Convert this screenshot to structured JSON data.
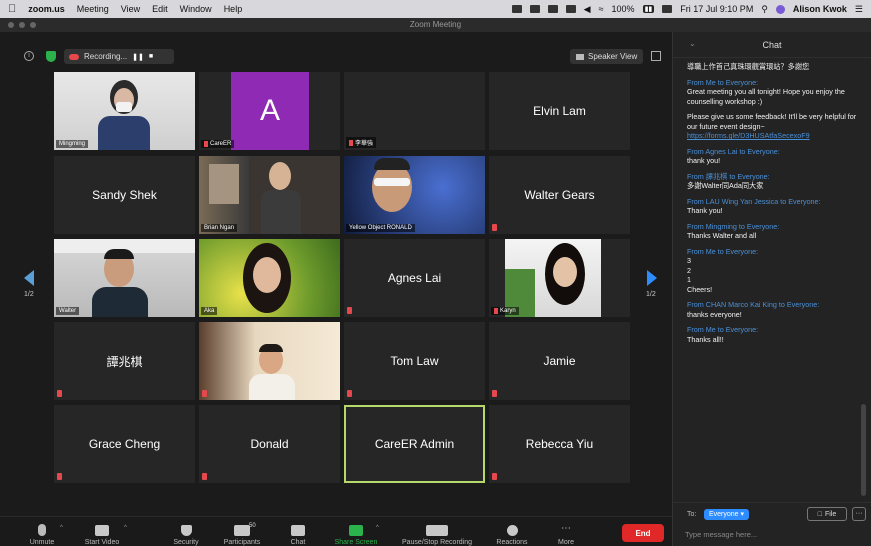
{
  "menubar": {
    "app": "zoom.us",
    "items": [
      "Meeting",
      "View",
      "Edit",
      "Window",
      "Help"
    ],
    "battery": "100%",
    "datetime": "Fri 17 Jul 9:10 PM",
    "user": "Alison Kwok"
  },
  "window": {
    "title": "Zoom Meeting"
  },
  "topbar": {
    "recording_label": "Recording...",
    "speaker_view": "Speaker View"
  },
  "pagination": {
    "left": "1/2",
    "right": "1/2"
  },
  "tiles": [
    {
      "name": "Mingming",
      "kind": "video"
    },
    {
      "name": "CareER",
      "kind": "avatar",
      "initial": "A"
    },
    {
      "name": "李華強",
      "kind": "label"
    },
    {
      "name": "Elvin Lam",
      "kind": "name"
    },
    {
      "name": "Sandy Shek",
      "kind": "name"
    },
    {
      "name": "Brian Ngan",
      "kind": "video"
    },
    {
      "name": "Yellow Object RONALD",
      "kind": "video"
    },
    {
      "name": "Walter Gears",
      "kind": "name"
    },
    {
      "name": "Walter",
      "kind": "video"
    },
    {
      "name": "Aka",
      "kind": "video"
    },
    {
      "name": "Agnes Lai",
      "kind": "name"
    },
    {
      "name": "Karyn",
      "kind": "video"
    },
    {
      "name": "譚兆棋",
      "kind": "name"
    },
    {
      "name": "",
      "kind": "video"
    },
    {
      "name": "Tom Law",
      "kind": "name"
    },
    {
      "name": "Jamie",
      "kind": "name"
    },
    {
      "name": "Grace Cheng",
      "kind": "name"
    },
    {
      "name": "Donald",
      "kind": "name"
    },
    {
      "name": "CareER Admin",
      "kind": "name"
    },
    {
      "name": "Rebecca Yiu",
      "kind": "name"
    }
  ],
  "toolbar": {
    "unmute": "Unmute",
    "start_video": "Start Video",
    "security": "Security",
    "participants": "Participants",
    "participants_count": "50",
    "chat": "Chat",
    "share_screen": "Share Screen",
    "recording": "Pause/Stop Recording",
    "reactions": "Reactions",
    "more": "More",
    "end": "End"
  },
  "chat": {
    "title": "Chat",
    "messages": [
      {
        "from": "",
        "text": "導職上作首己真珠環觀賞環站？多謝您"
      },
      {
        "from": "From Me to Everyone:",
        "text": "Great meeting you all tonight! Hope you enjoy the counselling workshop :)"
      },
      {
        "from": "",
        "text": "Please give us some feedback! It'll be very helpful for our future event design~",
        "link": "https://forms.gle/D3HUSAtfaSecexoF9"
      },
      {
        "from": "From Agnes Lai to Everyone:",
        "text": "thank you!"
      },
      {
        "from": "From 譚兆棋 to Everyone:",
        "text": "多謝Walter同Ada同大家"
      },
      {
        "from": "From LAU Wing Yan Jessica to Everyone:",
        "text": "Thank you!"
      },
      {
        "from": "From Mingming to Everyone:",
        "text": "Thanks Walter and all"
      },
      {
        "from": "From Me to Everyone:",
        "text": "3\n2\n1\nCheers!"
      },
      {
        "from": "From CHAN Marco Kai King to Everyone:",
        "text": "thanks everyone!"
      },
      {
        "from": "From Me to Everyone:",
        "text": "Thanks all!!"
      }
    ],
    "to_label": "To:",
    "recipient": "Everyone",
    "file_label": "File",
    "more_label": "···",
    "input_placeholder": "Type message here..."
  }
}
